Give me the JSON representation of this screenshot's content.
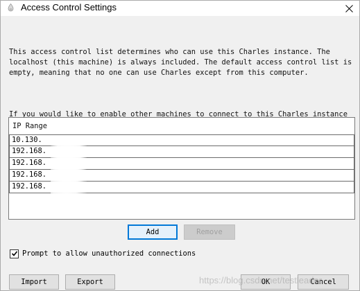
{
  "window": {
    "title": "Access Control Settings",
    "close_icon": "close-icon",
    "app_icon": "charles-app-icon"
  },
  "description": {
    "paragraph1": "This access control list determines who can use this Charles instance. The\nlocalhost (this machine) is always included. The default access control list is\nempty, meaning that no one can use Charles except from this computer.",
    "paragraph2": "If you would like to enable other machines to connect to this Charles instance\nenter IP addresses below, eg. 192.168.2.35 or fe80::7751:8349:cfe2:d2cc. You can\nalso specify subnets, eg. 192.168.2.0/24 or fc00::/64.To allow anyone to access\nCharles enter 0.0.0.0/0 for IPv4 connections and ::/0 for IPv6."
  },
  "ip_table": {
    "header": "IP Range",
    "rows": [
      "10.130.",
      "192.168.",
      "192.168.",
      "192.168.",
      "192.168."
    ]
  },
  "buttons": {
    "add": "Add",
    "remove": "Remove",
    "import": "Import",
    "export": "Export",
    "ok": "OK",
    "cancel": "Cancel"
  },
  "prompt_checkbox": {
    "label": "Prompt to allow unauthorized connections",
    "checked": true
  },
  "watermark": "https://blog.csdn.net/testleader",
  "colors": {
    "focus_accent": "#0078d7",
    "disabled_text": "#a0a0a0"
  }
}
